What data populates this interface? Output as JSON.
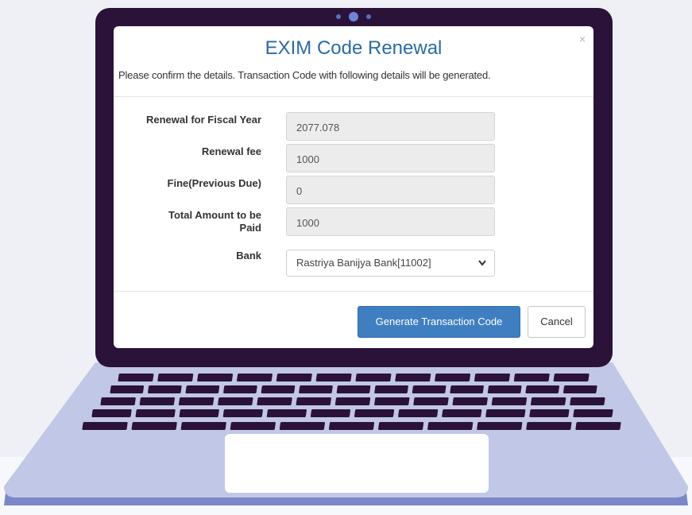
{
  "modal": {
    "title": "EXIM Code Renewal",
    "subtitle": "Please confirm the details. Transaction Code with following details will be generated.",
    "close_glyph": "×"
  },
  "form": {
    "fiscal_year": {
      "label": "Renewal for Fiscal Year",
      "value": "2077.078"
    },
    "renewal_fee": {
      "label": "Renewal fee",
      "value": "1000"
    },
    "fine": {
      "label": "Fine(Previous Due)",
      "value": "0"
    },
    "total": {
      "label_line1": "Total Amount to be",
      "label_line2": "Paid",
      "value": "1000"
    },
    "bank": {
      "label": "Bank",
      "selected": "Rastriya Banijya Bank[11002]"
    }
  },
  "buttons": {
    "generate": "Generate Transaction Code",
    "cancel": "Cancel"
  },
  "colors": {
    "laptop_frame": "#2b1238",
    "laptop_base": "#c1c7e6",
    "primary_button": "#3f7fc1",
    "title": "#2b6aa8"
  }
}
